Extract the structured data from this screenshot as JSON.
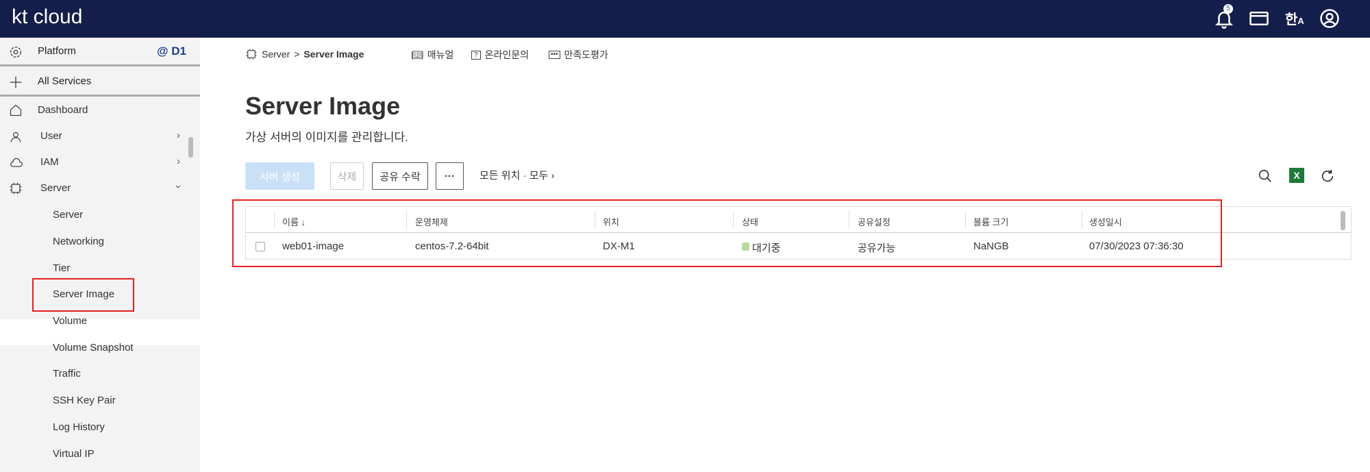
{
  "header": {
    "logo": "kt cloud",
    "notification_count": "5",
    "icons": [
      "bell-icon",
      "card-icon",
      "language-icon",
      "user-icon"
    ]
  },
  "sidebar": {
    "platform": {
      "label": "Platform",
      "region": "@ D1"
    },
    "all_services": "All Services",
    "items": [
      {
        "label": "Dashboard"
      },
      {
        "label": "User"
      },
      {
        "label": "IAM"
      },
      {
        "label": "Server"
      }
    ],
    "server_sub": [
      "Server",
      "Networking",
      "Tier",
      "Server Image",
      "Volume",
      "Volume Snapshot",
      "Traffic",
      "SSH Key Pair",
      "Log History",
      "Virtual IP"
    ]
  },
  "breadcrumb": {
    "parent": "Server",
    "sep": ">",
    "current": "Server Image"
  },
  "links": {
    "manual": "매뉴얼",
    "inquiry": "온라인문의",
    "survey": "만족도평가"
  },
  "page": {
    "title": "Server Image",
    "subtitle": "가상 서버의 이미지를 관리합니다."
  },
  "toolbar": {
    "create": "서버 생성",
    "delete": "삭제",
    "accept_share": "공유 수락",
    "more": "···",
    "filter": "모든 위치 · 모두 ›"
  },
  "table": {
    "columns": [
      "이름 ↓",
      "운영체제",
      "위치",
      "상태",
      "공유설정",
      "볼륨 크기",
      "생성일시"
    ],
    "rows": [
      {
        "name": "web01-image",
        "os": "centos-7.2-64bit",
        "location": "DX-M1",
        "status": "대기중",
        "share": "공유가능",
        "size": "NaNGB",
        "created": "07/30/2023 07:36:30"
      }
    ]
  },
  "colors": {
    "header": "#141e4a",
    "accent": "#1b3d8f",
    "highlight": "#e32020",
    "create_btn": "#c9e0f7"
  }
}
